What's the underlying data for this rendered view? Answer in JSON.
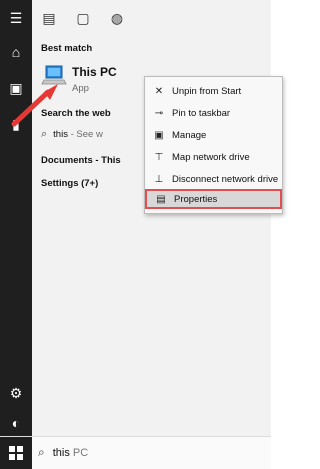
{
  "panel": {
    "best_match_label": "Best match",
    "best_match_title": "This PC",
    "best_match_sub": "App",
    "search_web_label": "Search the web",
    "web_query": "this",
    "web_see": " - See w",
    "documents_label": "Documents - This",
    "settings_label": "Settings (7+)"
  },
  "context_menu": {
    "items": [
      {
        "label": "Unpin from Start",
        "icon": "unpin-icon"
      },
      {
        "label": "Pin to taskbar",
        "icon": "pin-icon"
      },
      {
        "label": "Manage",
        "icon": "manage-icon"
      },
      {
        "label": "Map network drive",
        "icon": "network-drive-icon"
      },
      {
        "label": "Disconnect network drive",
        "icon": "disconnect-drive-icon"
      },
      {
        "label": "Properties",
        "icon": "properties-icon"
      }
    ],
    "highlighted_item": "Properties"
  },
  "taskbar": {
    "search_text": "this",
    "search_placeholder": " PC"
  },
  "colors": {
    "rail": "#1f1f1f",
    "panel": "#f2f2f2",
    "highlight_border": "#e05050",
    "arrow": "#e53935"
  }
}
